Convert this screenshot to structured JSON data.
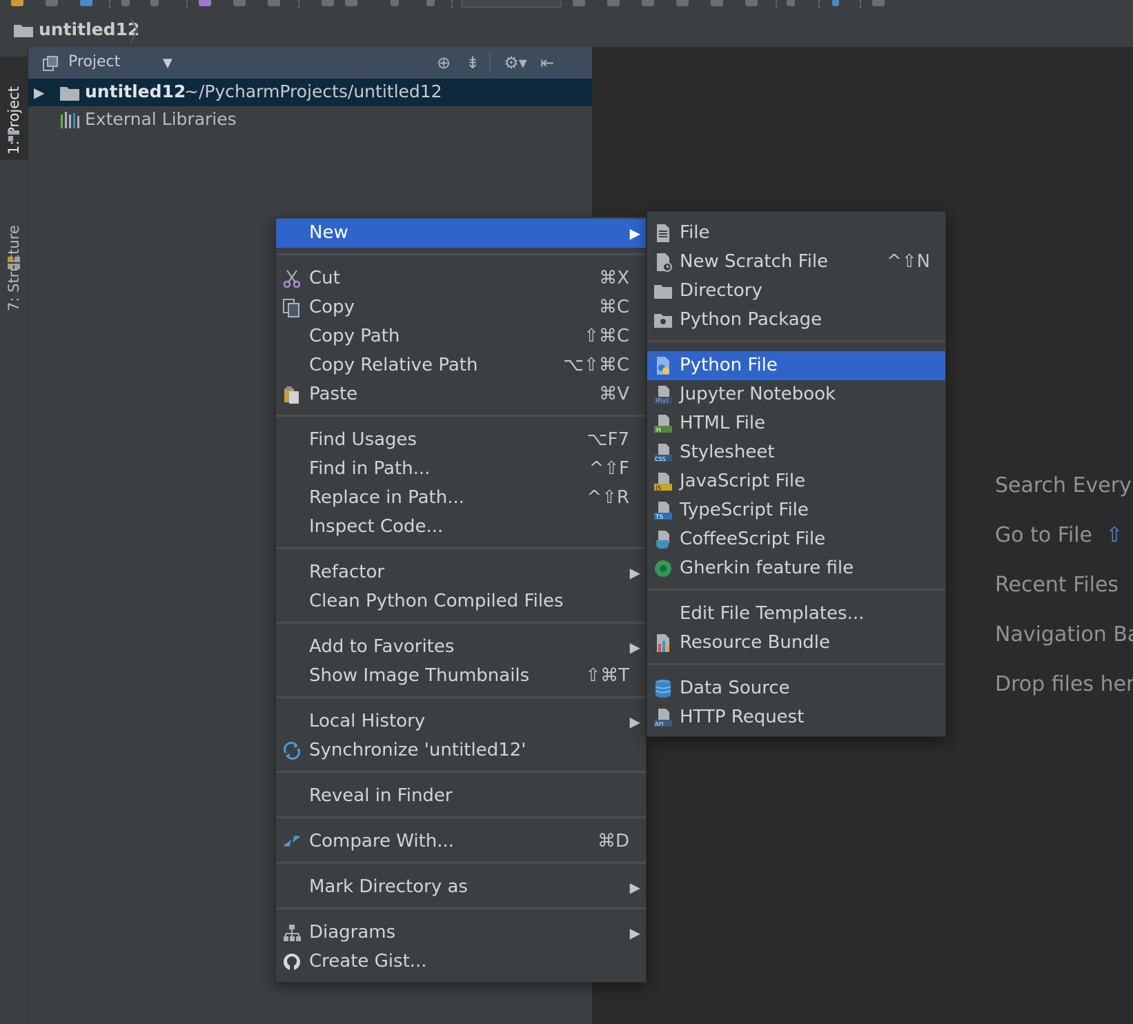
{
  "navbar": {
    "title": "untitled12"
  },
  "left_stripe": {
    "project_tab": "1: Project",
    "structure_tab": "7: Structure"
  },
  "project_panel": {
    "title": "Project",
    "tree": [
      {
        "name": "untitled12",
        "path": "~/PycharmProjects/untitled12"
      },
      {
        "name": "External Libraries"
      }
    ]
  },
  "context_menu": {
    "items": [
      {
        "label": "New",
        "shortcut": "",
        "submenu": true,
        "selected": true
      },
      {
        "label": "Cut",
        "shortcut": "⌘X",
        "icon": "scissors-icon"
      },
      {
        "label": "Copy",
        "shortcut": "⌘C",
        "icon": "copy-icon"
      },
      {
        "label": "Copy Path",
        "shortcut": "⇧⌘C"
      },
      {
        "label": "Copy Relative Path",
        "shortcut": "⌥⇧⌘C"
      },
      {
        "label": "Paste",
        "shortcut": "⌘V",
        "icon": "paste-icon"
      },
      {
        "label": "Find Usages",
        "shortcut": "⌥F7"
      },
      {
        "label": "Find in Path...",
        "shortcut": "^⇧F"
      },
      {
        "label": "Replace in Path...",
        "shortcut": "^⇧R"
      },
      {
        "label": "Inspect Code...",
        "shortcut": ""
      },
      {
        "label": "Refactor",
        "shortcut": "",
        "submenu": true
      },
      {
        "label": "Clean Python Compiled Files",
        "shortcut": ""
      },
      {
        "label": "Add to Favorites",
        "shortcut": "",
        "submenu": true
      },
      {
        "label": "Show Image Thumbnails",
        "shortcut": "⇧⌘T"
      },
      {
        "label": "Local History",
        "shortcut": "",
        "submenu": true
      },
      {
        "label": "Synchronize 'untitled12'",
        "shortcut": "",
        "icon": "sync-icon"
      },
      {
        "label": "Reveal in Finder",
        "shortcut": ""
      },
      {
        "label": "Compare With...",
        "shortcut": "⌘D",
        "icon": "compare-icon"
      },
      {
        "label": "Mark Directory as",
        "shortcut": "",
        "submenu": true
      },
      {
        "label": "Diagrams",
        "shortcut": "",
        "submenu": true,
        "icon": "diagram-icon"
      },
      {
        "label": "Create Gist...",
        "shortcut": "",
        "icon": "github-icon"
      }
    ]
  },
  "new_submenu": {
    "items": [
      {
        "label": "File",
        "shortcut": "",
        "icon": "file-icon"
      },
      {
        "label": "New Scratch File",
        "shortcut": "^⇧N",
        "icon": "scratch-file-icon"
      },
      {
        "label": "Directory",
        "shortcut": "",
        "icon": "folder-icon"
      },
      {
        "label": "Python Package",
        "shortcut": "",
        "icon": "package-icon"
      },
      {
        "label": "Python File",
        "shortcut": "",
        "icon": "python-file-icon",
        "selected": true
      },
      {
        "label": "Jupyter Notebook",
        "shortcut": "",
        "icon": "jupyter-icon",
        "badge": "IP[y]"
      },
      {
        "label": "HTML File",
        "shortcut": "",
        "icon": "html-file-icon",
        "badge": "H"
      },
      {
        "label": "Stylesheet",
        "shortcut": "",
        "icon": "css-file-icon",
        "badge": "CSS"
      },
      {
        "label": "JavaScript File",
        "shortcut": "",
        "icon": "js-file-icon",
        "badge": "JS"
      },
      {
        "label": "TypeScript File",
        "shortcut": "",
        "icon": "ts-file-icon",
        "badge": "TS"
      },
      {
        "label": "CoffeeScript File",
        "shortcut": "",
        "icon": "coffeescript-icon"
      },
      {
        "label": "Gherkin feature file",
        "shortcut": "",
        "icon": "gherkin-icon"
      },
      {
        "label": "Edit File Templates...",
        "shortcut": ""
      },
      {
        "label": "Resource Bundle",
        "shortcut": "",
        "icon": "resource-bundle-icon"
      },
      {
        "label": "Data Source",
        "shortcut": "",
        "icon": "database-icon"
      },
      {
        "label": "HTTP Request",
        "shortcut": "",
        "icon": "api-icon",
        "badge": "API"
      }
    ]
  },
  "editor_hints": [
    {
      "label": "Search Every"
    },
    {
      "label": "Go to File",
      "glyph": "⇧"
    },
    {
      "label": "Recent Files"
    },
    {
      "label": "Navigation Ba"
    },
    {
      "label": "Drop files her"
    }
  ],
  "colors": {
    "selection": "#2f65ca",
    "menu_bg": "#3c3f41",
    "editor_bg": "#2b2b2b",
    "tree_selection": "#0d293e"
  }
}
